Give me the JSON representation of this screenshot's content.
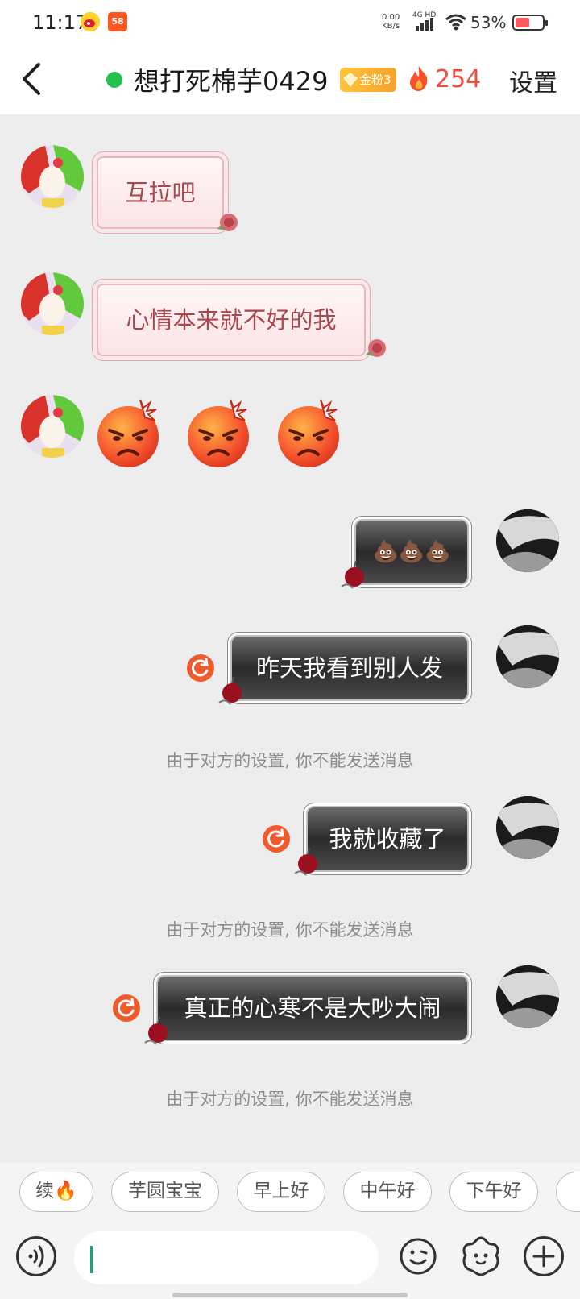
{
  "status_bar": {
    "time": "11:17",
    "network_speed_value": "0.00",
    "network_speed_unit": "KB/s",
    "network_type": "4G HD",
    "battery_percent": "53%",
    "battery_level": 0.53,
    "app_icons": [
      "weibo-icon",
      "58-app-icon"
    ],
    "app_badge_58": "58"
  },
  "header": {
    "title": "想打死棉芋0429",
    "fan_badge": "金粉3",
    "fire_count": "254",
    "settings_label": "设置",
    "online_color": "#25c04b"
  },
  "messages": [
    {
      "side": "left",
      "type": "text",
      "text": "互拉吧"
    },
    {
      "side": "left",
      "type": "text",
      "text": "心情本来就不好的我"
    },
    {
      "side": "left",
      "type": "emoji",
      "emoji": [
        "angry-face-icon",
        "angry-face-icon",
        "angry-face-icon"
      ]
    },
    {
      "side": "right",
      "type": "emoji",
      "text": "💩💩💩"
    },
    {
      "side": "right",
      "type": "text",
      "text": "昨天我看到别人发",
      "failed": true,
      "notice": "由于对方的设置, 你不能发送消息"
    },
    {
      "side": "right",
      "type": "text",
      "text": "我就收藏了",
      "failed": true,
      "notice": "由于对方的设置, 你不能发送消息"
    },
    {
      "side": "right",
      "type": "text",
      "text": "真正的心寒不是大吵大闹",
      "failed": true,
      "notice": "由于对方的设置, 你不能发送消息"
    }
  ],
  "quick_replies": [
    "续🔥",
    "芋圆宝宝",
    "早上好",
    "中午好",
    "下午好"
  ],
  "input": {
    "placeholder": "",
    "icons": [
      "voice-icon",
      "emoji-icon",
      "sticker-icon",
      "plus-icon"
    ]
  },
  "colors": {
    "accent_red": "#f24a3c",
    "retry_orange": "#f05a2d",
    "background": "#ededed"
  }
}
